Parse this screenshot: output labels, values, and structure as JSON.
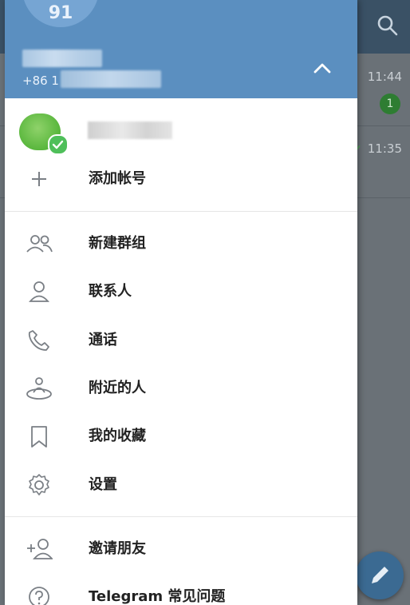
{
  "background": {
    "rows": [
      {
        "time": "11:44",
        "badge": "1"
      },
      {
        "time": "11:35",
        "check": "✓"
      }
    ]
  },
  "header": {
    "avatar_text": "91",
    "phone_prefix": "+86 1"
  },
  "menu": {
    "add_account": "添加帐号",
    "new_group": "新建群组",
    "contacts": "联系人",
    "calls": "通话",
    "people_nearby": "附近的人",
    "saved_messages": "我的收藏",
    "settings": "设置",
    "invite_friends": "邀请朋友",
    "faq": "Telegram 常见问题"
  },
  "colors": {
    "header": "#5b8fc0",
    "drawer_bg": "#ffffff",
    "icon": "#7a7f85"
  }
}
